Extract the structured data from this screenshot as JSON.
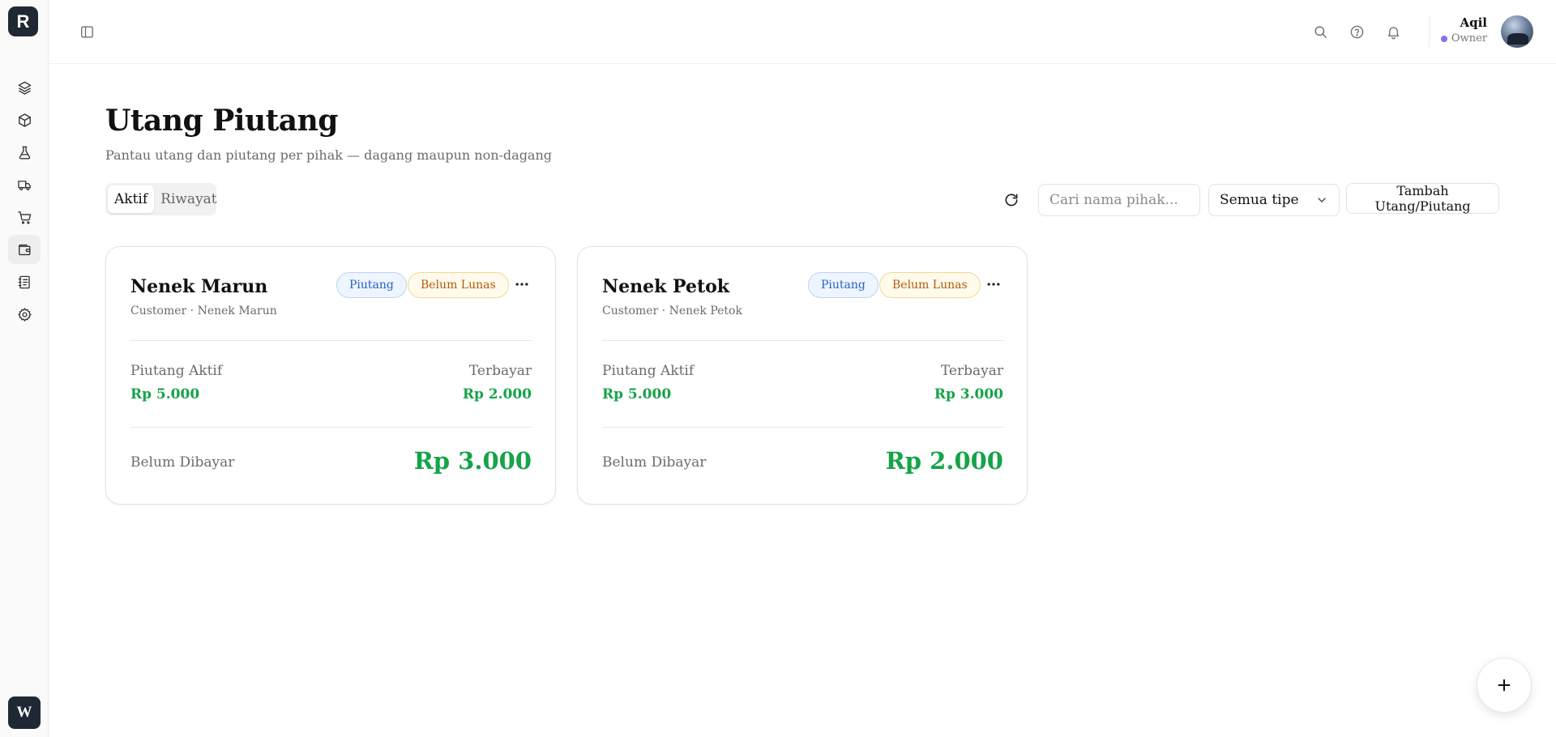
{
  "app": {
    "logo_letter": "R",
    "workspace_letter": "W"
  },
  "sidebar": {
    "items": [
      {
        "icon": "layers-icon"
      },
      {
        "icon": "box-icon"
      },
      {
        "icon": "flask-icon"
      },
      {
        "icon": "truck-icon"
      },
      {
        "icon": "cart-icon"
      },
      {
        "icon": "wallet-icon",
        "active": true
      },
      {
        "icon": "notebook-icon"
      },
      {
        "icon": "gear-icon"
      }
    ]
  },
  "topbar": {
    "icons": [
      "sidebar-toggle-icon",
      "search-icon",
      "help-icon",
      "bell-icon"
    ],
    "user": {
      "name": "Aqil",
      "role": "Owner",
      "role_color": "#8b6cf6"
    }
  },
  "page": {
    "title": "Utang Piutang",
    "subtitle": "Pantau utang dan piutang per pihak — dagang maupun non-dagang"
  },
  "tabs": [
    {
      "label": "Aktif",
      "active": true
    },
    {
      "label": "Riwayat",
      "active": false
    }
  ],
  "toolbar": {
    "search_placeholder": "Cari nama pihak...",
    "type_filter_value": "Semua tipe",
    "add_label": "Tambah Utang/Piutang"
  },
  "cards": [
    {
      "name": "Nenek Marun",
      "meta": "Customer · Nenek Marun",
      "type_badge": "Piutang",
      "status_badge": "Belum Lunas",
      "active_label": "Piutang Aktif",
      "active_value": "Rp 5.000",
      "paid_label": "Terbayar",
      "paid_value": "Rp 2.000",
      "due_label": "Belum Dibayar",
      "due_value": "Rp 3.000"
    },
    {
      "name": "Nenek Petok",
      "meta": "Customer · Nenek Petok",
      "type_badge": "Piutang",
      "status_badge": "Belum Lunas",
      "active_label": "Piutang Aktif",
      "active_value": "Rp 5.000",
      "paid_label": "Terbayar",
      "paid_value": "Rp 3.000",
      "due_label": "Belum Dibayar",
      "due_value": "Rp 2.000"
    }
  ],
  "colors": {
    "accent_green": "#16a34a",
    "badge_blue": "#2462c9",
    "badge_amber": "#b45a0c",
    "dark": "#1f2833"
  }
}
